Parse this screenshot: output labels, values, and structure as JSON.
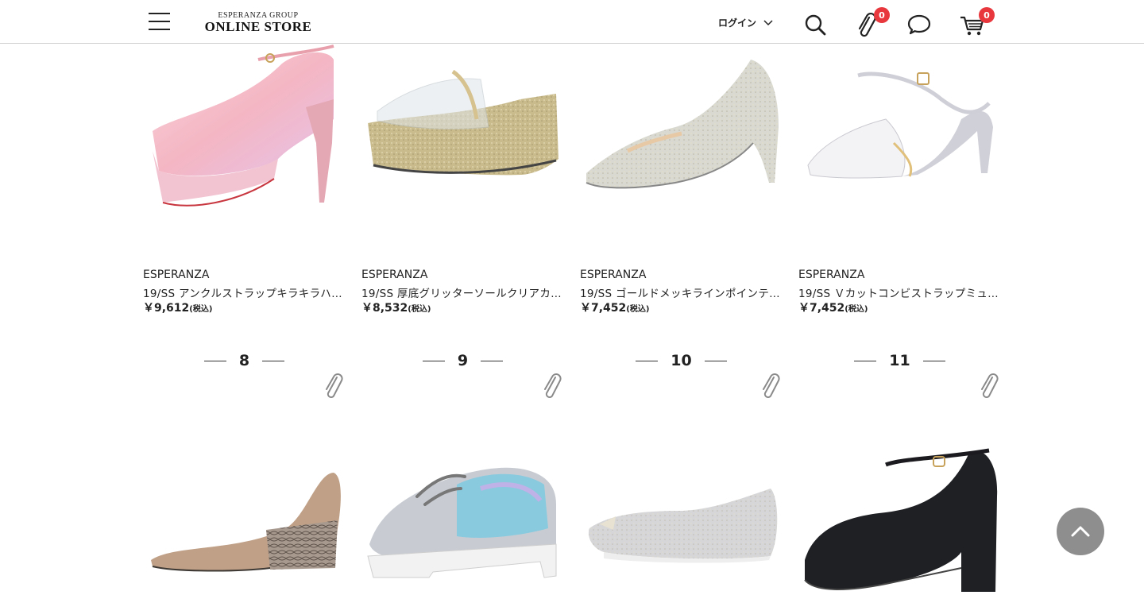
{
  "header": {
    "logo_top": "ESPERANZA GROUP",
    "logo_main": "ONLINE STORE",
    "login_label": "ログイン",
    "favorites_count": "0",
    "cart_count": "0"
  },
  "products_row1": [
    {
      "brand": "ESPERANZA",
      "name": "19/SS アンクルストラップキラキラハ…",
      "price": "￥9,612",
      "tax": "(税込)"
    },
    {
      "brand": "ESPERANZA",
      "name": "19/SS 厚底グリッターソールクリアカ…",
      "price": "￥8,532",
      "tax": "(税込)"
    },
    {
      "brand": "ESPERANZA",
      "name": "19/SS ゴールドメッキラインポインテ…",
      "price": "￥7,452",
      "tax": "(税込)"
    },
    {
      "brand": "ESPERANZA",
      "name": "19/SS Ｖカットコンビストラップミュ…",
      "price": "￥7,452",
      "tax": "(税込)"
    }
  ],
  "ranks": [
    "8",
    "9",
    "10",
    "11"
  ],
  "colors": {
    "badge": "#e8383d",
    "back_to_top": "#8e8e8e",
    "header_border": "#cfcfcf"
  },
  "icons": [
    "menu-icon",
    "chevron-down-icon",
    "search-icon",
    "paperclip-icon",
    "chat-icon",
    "cart-icon",
    "chevron-up-icon"
  ]
}
